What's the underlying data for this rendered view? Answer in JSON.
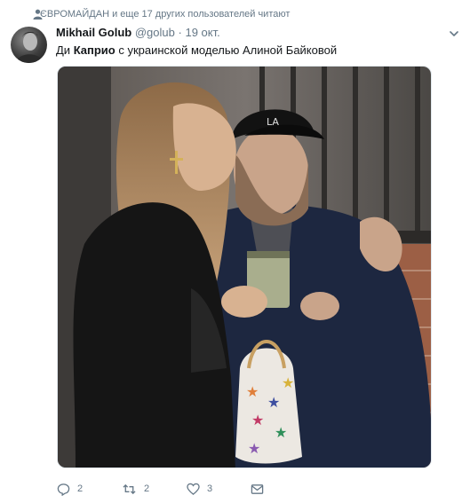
{
  "context": {
    "text": "ЄВРОМАЙДАН и еще 17 других пользователей читают",
    "icon": "person-icon"
  },
  "tweet": {
    "author_name": "Mikhail Golub",
    "handle": "@golub",
    "separator": "·",
    "time": "19 окт.",
    "text_prefix": "Ди ",
    "text_bold": "Каприо",
    "text_suffix": " с украинской моделью Алиной Байковой"
  },
  "actions": {
    "reply_count": "2",
    "retweet_count": "2",
    "like_count": "3"
  },
  "colors": {
    "muted": "#657786",
    "text": "#14171a",
    "border": "#e1e8ed"
  }
}
